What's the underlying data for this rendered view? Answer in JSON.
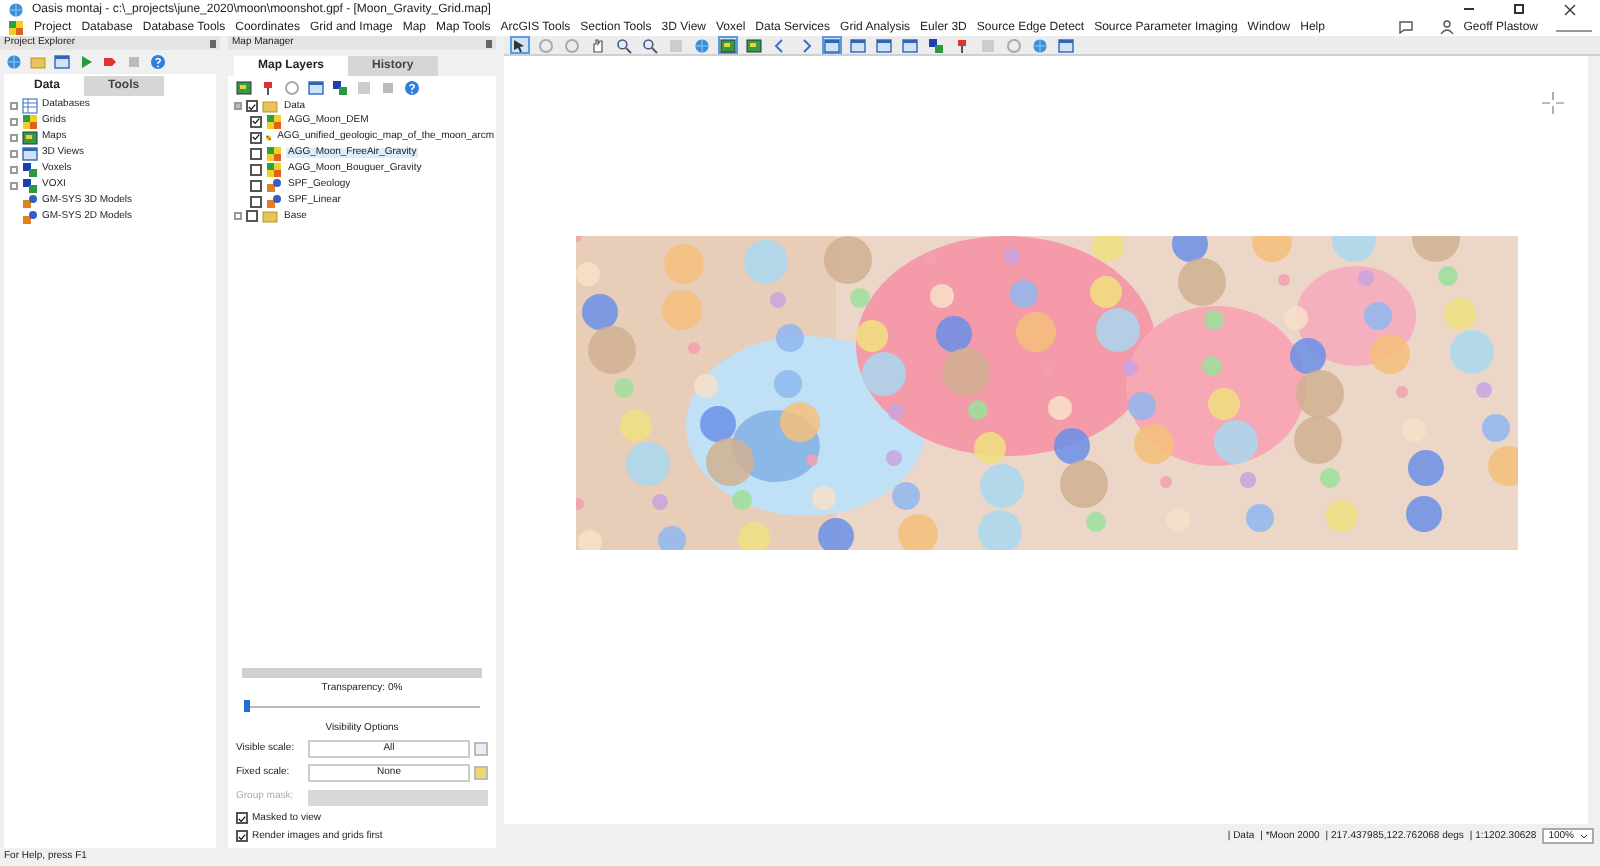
{
  "window": {
    "title": "Oasis montaj - c:\\_projects\\june_2020\\moon\\moonshot.gpf - [Moon_Gravity_Grid.map]"
  },
  "menu": [
    "Project",
    "Database",
    "Database Tools",
    "Coordinates",
    "Grid and Image",
    "Map",
    "Map Tools",
    "ArcGIS Tools",
    "Section Tools",
    "3D View",
    "Voxel",
    "Data Services",
    "Grid Analysis",
    "Euler 3D",
    "Source Edge Detect",
    "Source Parameter Imaging",
    "Window",
    "Help"
  ],
  "user": {
    "name": "Geoff Plastow"
  },
  "project_explorer": {
    "title": "Project Explorer",
    "tabs": [
      {
        "label": "Data",
        "selected": true
      },
      {
        "label": "Tools",
        "selected": false
      }
    ],
    "tree": [
      {
        "label": "Databases",
        "expandable": true
      },
      {
        "label": "Grids",
        "expandable": true
      },
      {
        "label": "Maps",
        "expandable": true
      },
      {
        "label": "3D Views",
        "expandable": true
      },
      {
        "label": "Voxels",
        "expandable": true
      },
      {
        "label": "VOXI",
        "expandable": true
      },
      {
        "label": "GM-SYS 3D Models",
        "expandable": false
      },
      {
        "label": "GM-SYS 2D Models",
        "expandable": false
      }
    ]
  },
  "map_manager": {
    "title": "Map Manager",
    "tabs": [
      {
        "label": "Map Layers",
        "selected": true
      },
      {
        "label": "History",
        "selected": false
      }
    ],
    "layers": [
      {
        "label": "Data",
        "checked": true,
        "expanded": true,
        "selected": false,
        "children": [
          {
            "label": "AGG_Moon_DEM",
            "checked": true,
            "selected": false,
            "kind": "grid"
          },
          {
            "label": "AGG_unified_geologic_map_of_the_moon_arcm",
            "checked": true,
            "selected": false,
            "kind": "grid"
          },
          {
            "label": "AGG_Moon_FreeAir_Gravity",
            "checked": false,
            "selected": true,
            "kind": "grid"
          },
          {
            "label": "AGG_Moon_Bouguer_Gravity",
            "checked": false,
            "selected": false,
            "kind": "grid"
          },
          {
            "label": "SPF_Geology",
            "checked": false,
            "selected": false,
            "kind": "vector"
          },
          {
            "label": "SPF_Linear",
            "checked": false,
            "selected": false,
            "kind": "vector"
          }
        ]
      },
      {
        "label": "Base",
        "checked": false,
        "expanded": false,
        "selected": false
      }
    ],
    "transparency": {
      "label": "Transparency: 0%",
      "level": 0
    },
    "visibility_title": "Visibility Options",
    "fields": [
      {
        "label": "Visible scale:",
        "value": "All",
        "disabled": false
      },
      {
        "label": "Fixed scale:",
        "value": "None",
        "disabled": false
      },
      {
        "label": "Group mask:",
        "disabled": true
      }
    ],
    "options": [
      {
        "label": "Masked to view",
        "checked": true
      },
      {
        "label": "Render images and grids first",
        "checked": true
      }
    ]
  },
  "map_toolbar": [
    {
      "selected": true
    },
    {
      "selected": false
    },
    {
      "selected": false
    },
    {
      "selected": false
    },
    {
      "selected": false
    },
    {
      "selected": false
    },
    {
      "selected": false
    },
    {
      "selected": false
    },
    {
      "selected": true
    },
    {
      "selected": false
    },
    {
      "selected": false
    },
    {
      "selected": false
    },
    {
      "selected": true
    },
    {
      "selected": false
    },
    {
      "selected": false
    },
    {
      "selected": false
    },
    {
      "selected": false
    },
    {
      "selected": false
    },
    {
      "selected": false
    },
    {
      "selected": false
    },
    {
      "selected": false
    },
    {
      "selected": false
    }
  ],
  "map_status": [
    "| Data",
    "| *Moon 2000",
    "| 217.437985,122.762068 degs",
    "| 1:1202.30628"
  ],
  "zoom": "100%",
  "status_bar": "For Help, press F1"
}
